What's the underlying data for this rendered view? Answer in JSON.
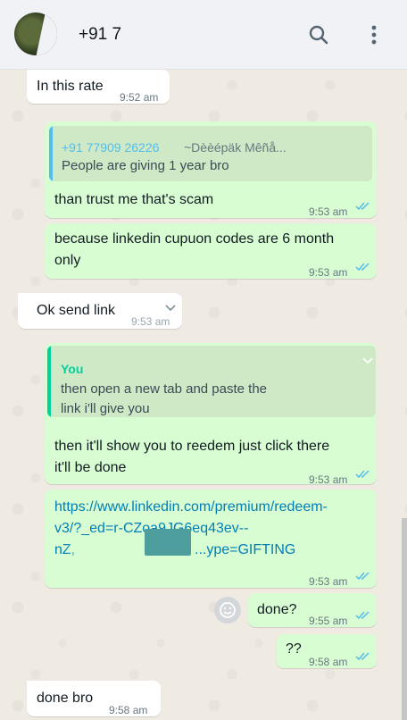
{
  "header": {
    "contact_name": "+91 7",
    "search_icon": "search-icon",
    "menu_icon": "kebab-menu-icon"
  },
  "messages": [
    {
      "dir": "in",
      "text": "In this rate",
      "time": "9:52 am"
    },
    {
      "dir": "out",
      "quote": {
        "author": "+91 77909 26226",
        "author_alias": "~Dèèépäk Mêñå...",
        "text": "People are giving 1 year bro"
      },
      "text": "than trust me that's scam",
      "time": "9:53 am"
    },
    {
      "dir": "out",
      "text_lines": [
        "because linkedin cupuon codes are 6 month",
        "only"
      ],
      "time": "9:53 am"
    },
    {
      "dir": "in",
      "text": "Ok send link",
      "time": "9:53 am"
    },
    {
      "dir": "out",
      "quote": {
        "author": "You",
        "text_lines": [
          "then open a new tab and paste the",
          "link i'll give you"
        ]
      },
      "text_lines": [
        "then it'll show you to reedem just click there",
        "it'll be done"
      ],
      "time": "9:53 am"
    },
    {
      "dir": "out",
      "link_lines": [
        "https://www.linkedin.com/premium/redeem-",
        "v3/?_ed=r-CZoa9JG6eq43ev--",
        "nZ,",
        "...ype=GIFTING"
      ],
      "time": "9:53 am"
    },
    {
      "dir": "out",
      "text": "done?",
      "time": "9:55 am"
    },
    {
      "dir": "out",
      "text": "??",
      "time": "9:58 am"
    },
    {
      "dir": "in",
      "text": "done bro",
      "time": "9:58 am"
    }
  ],
  "colors": {
    "outgoing_bubble": "#d9fdd3",
    "incoming_bubble": "#ffffff",
    "read_ticks": "#53bdeb",
    "quote_bar_other": "#53bdeb",
    "quote_bar_you": "#06cf9c",
    "quote_name_other": "#53bdeb",
    "quote_name_you": "#06cf9c",
    "link": "#027eb5"
  }
}
